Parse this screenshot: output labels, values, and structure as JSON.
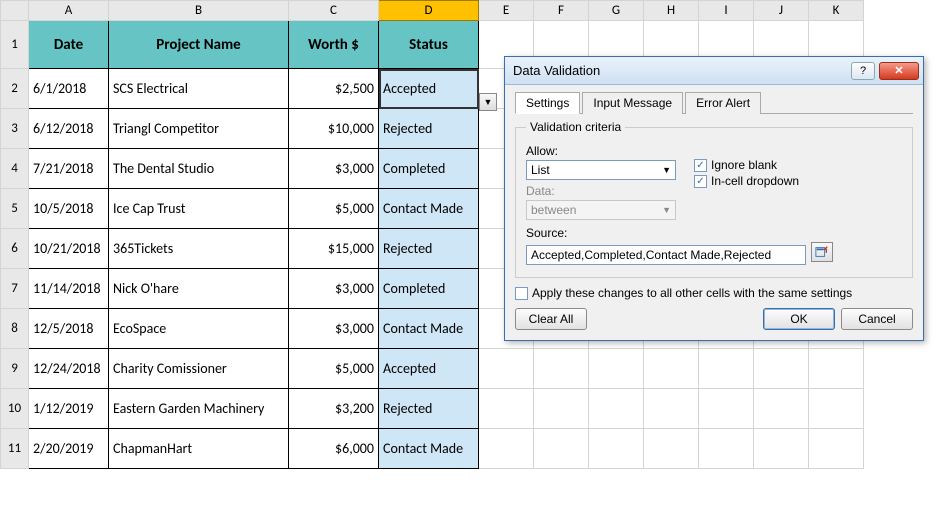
{
  "columns": [
    "A",
    "B",
    "C",
    "D",
    "E",
    "F",
    "G",
    "H",
    "I",
    "J",
    "K"
  ],
  "selected_column": "D",
  "selected_rows": [],
  "headers": {
    "A": "Date",
    "B": "Project Name",
    "C": "Worth $",
    "D": "Status"
  },
  "rows": [
    {
      "rn": "2",
      "date": "6/1/2018",
      "name": "SCS Electrical",
      "worth": "$2,500",
      "status": "Accepted"
    },
    {
      "rn": "3",
      "date": "6/12/2018",
      "name": "Triangl Competitor",
      "worth": "$10,000",
      "status": "Rejected"
    },
    {
      "rn": "4",
      "date": "7/21/2018",
      "name": "The Dental Studio",
      "worth": "$3,000",
      "status": "Completed"
    },
    {
      "rn": "5",
      "date": "10/5/2018",
      "name": "Ice Cap Trust",
      "worth": "$5,000",
      "status": "Contact Made"
    },
    {
      "rn": "6",
      "date": "10/21/2018",
      "name": "365Tickets",
      "worth": "$15,000",
      "status": "Rejected"
    },
    {
      "rn": "7",
      "date": "11/14/2018",
      "name": "Nick O'hare",
      "worth": "$3,000",
      "status": "Completed"
    },
    {
      "rn": "8",
      "date": "12/5/2018",
      "name": "EcoSpace",
      "worth": "$3,000",
      "status": "Contact Made"
    },
    {
      "rn": "9",
      "date": "12/24/2018",
      "name": "Charity Comissioner",
      "worth": "$5,000",
      "status": "Accepted"
    },
    {
      "rn": "10",
      "date": "1/12/2019",
      "name": "Eastern Garden Machinery",
      "worth": "$3,200",
      "status": "Rejected"
    },
    {
      "rn": "11",
      "date": "2/20/2019",
      "name": "ChapmanHart",
      "worth": "$6,000",
      "status": "Contact Made"
    }
  ],
  "active_cell": "D2",
  "dialog": {
    "title": "Data Validation",
    "tabs": {
      "settings": "Settings",
      "input_message": "Input Message",
      "error_alert": "Error Alert"
    },
    "active_tab": "settings",
    "legend": "Validation criteria",
    "allow_label": "Allow:",
    "allow_value": "List",
    "data_label": "Data:",
    "data_value": "between",
    "ignore_blank": "Ignore blank",
    "incell_dropdown": "In-cell dropdown",
    "source_label": "Source:",
    "source_value": "Accepted,Completed,Contact Made,Rejected",
    "apply_same": "Apply these changes to all other cells with the same settings",
    "clear_all": "Clear All",
    "ok": "OK",
    "cancel": "Cancel"
  }
}
